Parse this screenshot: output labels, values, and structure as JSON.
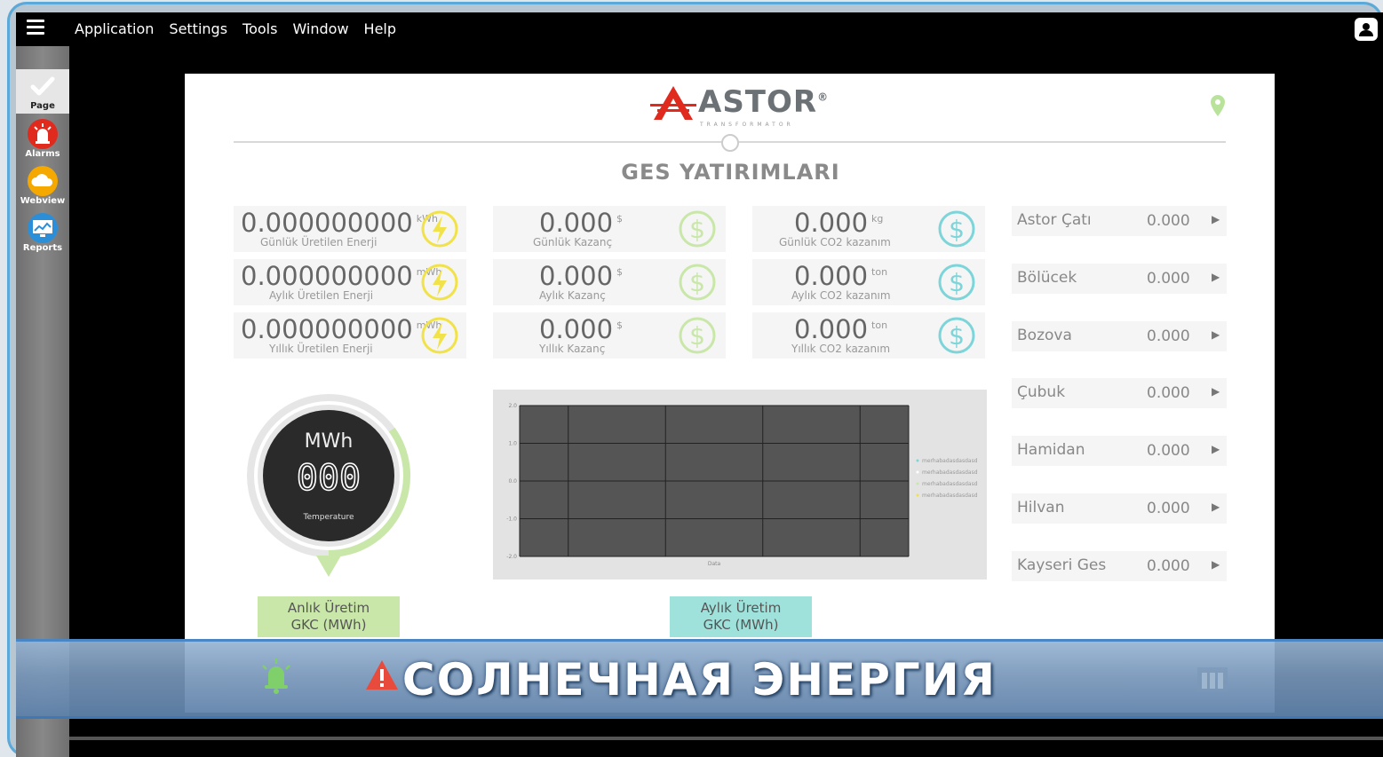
{
  "menubar": {
    "items": [
      "Application",
      "Settings",
      "Tools",
      "Window",
      "Help"
    ]
  },
  "sidebar": {
    "items": [
      {
        "label": "Page",
        "icon": "check-icon",
        "active": true
      },
      {
        "label": "Alarms",
        "icon": "alarm-siren-icon",
        "color": "#e02a1e"
      },
      {
        "label": "Webview",
        "icon": "cloud-icon",
        "color": "#f5a800"
      },
      {
        "label": "Reports",
        "icon": "report-screen-icon",
        "color": "#2a8fd8"
      }
    ]
  },
  "header": {
    "logo_text": "ASTOR",
    "logo_registered": "®",
    "logo_subtitle": "TRANSFORMATOR",
    "title": "GES YATIRIMLARI"
  },
  "energy_cards": [
    {
      "value": "0.000000000",
      "unit": "kWh",
      "caption": "Günlük Üretilen Enerji"
    },
    {
      "value": "0.000000000",
      "unit": "mWh",
      "caption": "Aylık Üretilen Enerji"
    },
    {
      "value": "0.000000000",
      "unit": "mWh",
      "caption": "Yıllık Üretilen Enerji"
    }
  ],
  "gain_cards": [
    {
      "value": "0.000",
      "unit": "$",
      "caption": "Günlük Kazanç"
    },
    {
      "value": "0.000",
      "unit": "$",
      "caption": "Aylık Kazanç"
    },
    {
      "value": "0.000",
      "unit": "$",
      "caption": "Yıllık Kazanç"
    }
  ],
  "co2_cards": [
    {
      "value": "0.000",
      "unit": "kg",
      "caption": "Günlük CO2 kazanım"
    },
    {
      "value": "0.000",
      "unit": "ton",
      "caption": "Aylık CO2 kazanım"
    },
    {
      "value": "0.000",
      "unit": "ton",
      "caption": "Yıllık CO2 kazanım"
    }
  ],
  "locations": [
    {
      "name": "Astor Çatı",
      "value": "0.000",
      "arrow": "▶"
    },
    {
      "name": "Bölücek",
      "value": "0.000",
      "arrow": "▶"
    },
    {
      "name": "Bozova",
      "value": "0.000",
      "arrow": "▶"
    },
    {
      "name": "Çubuk",
      "value": "0.000",
      "arrow": "▶"
    },
    {
      "name": "Hamidan",
      "value": "0.000",
      "arrow": "▶"
    },
    {
      "name": "Hilvan",
      "value": "0.000",
      "arrow": "▶"
    },
    {
      "name": "Kayseri Ges",
      "value": "0.000",
      "arrow": "▶"
    }
  ],
  "gauge": {
    "unit": "MWh",
    "digits": "000",
    "label": "Temperature",
    "button_line1": "Anlık Üretim",
    "button_line2": "GKC (MWh)",
    "fill_fraction": 0.35
  },
  "chart_data": {
    "type": "line",
    "title": "",
    "xlabel": "Data",
    "ylabel": "",
    "ylim": [
      -2.0,
      2.0
    ],
    "yticks": [
      "2.0",
      "1.0",
      "0.0",
      "-1.0",
      "-2.0"
    ],
    "series": [
      {
        "name": "merhabadasdasdasd",
        "values": []
      },
      {
        "name": "merhabadasdasdasd",
        "values": []
      },
      {
        "name": "merhabadasdasdasd",
        "values": []
      },
      {
        "name": "merhabadasdasdasd",
        "values": []
      }
    ],
    "grid": true,
    "legend": "right"
  },
  "chart_button": {
    "line1": "Aylık Üretim",
    "line2": "GKC (MWh)"
  },
  "footer": {
    "caption": "СОЛНЕЧНАЯ ЭНЕРГИЯ"
  },
  "colors": {
    "energy_icon": "#f1e24a",
    "gain_icon": "#c9e7a9",
    "co2_icon": "#7ed5d9",
    "gauge_green": "#c9e7a9",
    "chart_bg": "#555555"
  }
}
